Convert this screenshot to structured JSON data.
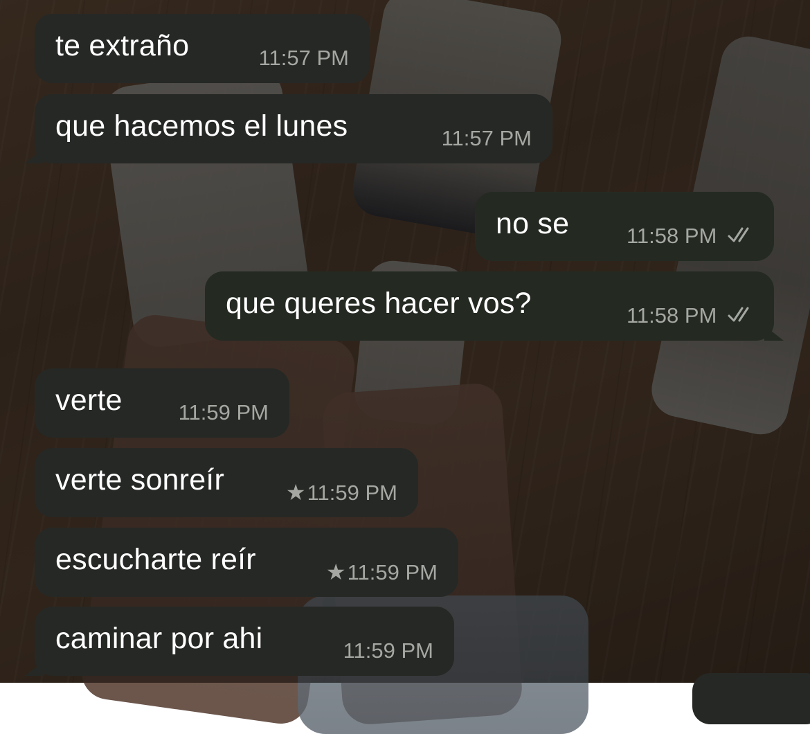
{
  "chat": {
    "messages": [
      {
        "direction": "incoming",
        "text": "te extraño",
        "time": "11:57 PM",
        "starred": false
      },
      {
        "direction": "incoming",
        "text": "que hacemos el lunes",
        "time": "11:57 PM",
        "starred": false
      },
      {
        "direction": "outgoing",
        "text": "no se",
        "time": "11:58 PM",
        "status_icon": "double-check-icon"
      },
      {
        "direction": "outgoing",
        "text": "que queres hacer vos?",
        "time": "11:58 PM",
        "status_icon": "double-check-icon"
      },
      {
        "direction": "incoming",
        "text": "verte",
        "time": "11:59 PM",
        "starred": false
      },
      {
        "direction": "incoming",
        "text": "verte sonreír",
        "time": "11:59 PM",
        "starred": true
      },
      {
        "direction": "incoming",
        "text": "escucharte reír",
        "time": "11:59 PM",
        "starred": true
      },
      {
        "direction": "incoming",
        "text": "caminar por ahi",
        "time": "11:59 PM",
        "starred": false
      }
    ]
  },
  "colors": {
    "incoming_bubble": "#262825",
    "outgoing_bubble": "#242a22",
    "message_text": "#ffffff",
    "meta_text": "#a5a7a2"
  },
  "icons": {
    "star": "star-icon",
    "read_receipt": "double-check-icon"
  }
}
